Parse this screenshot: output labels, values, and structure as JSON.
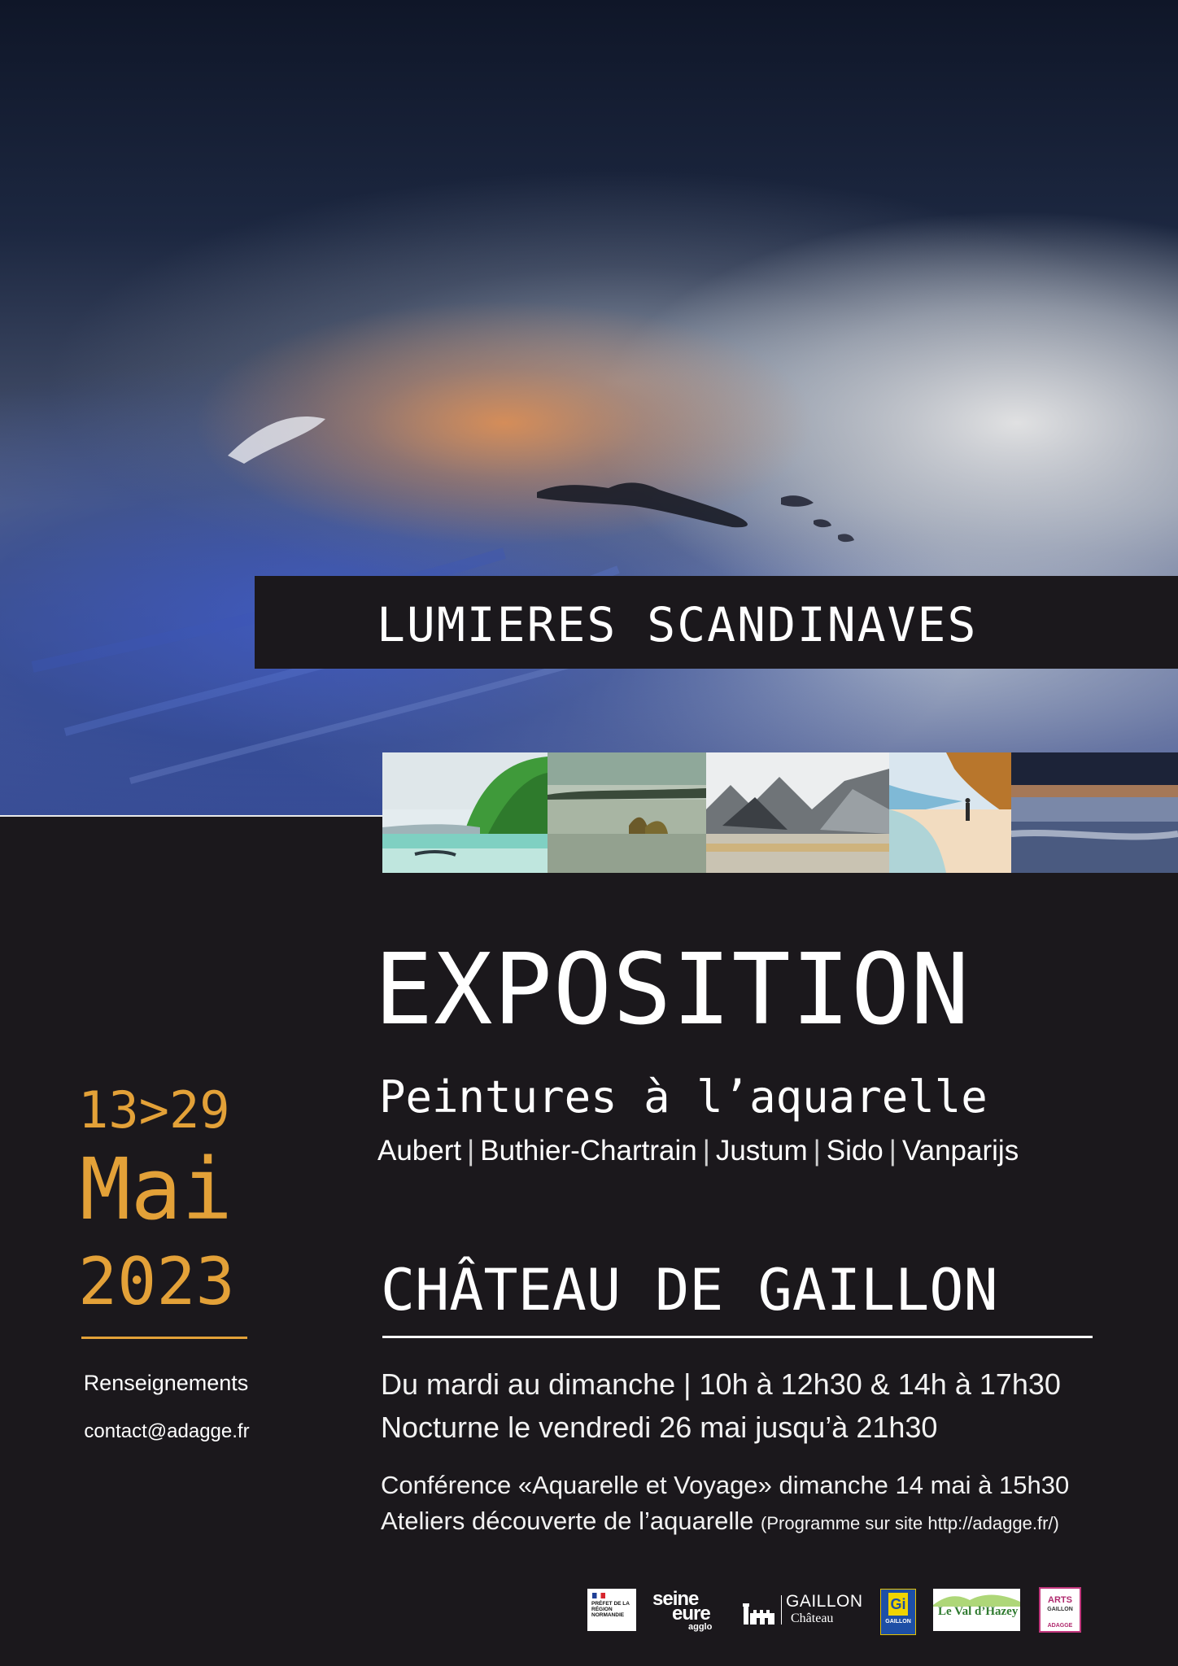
{
  "banner": {
    "title": "LUMIERES SCANDINAVES"
  },
  "main": {
    "heading": "EXPOSITION",
    "subtitle": "Peintures à l’aquarelle",
    "artists": [
      "Aubert",
      "Buthier-Chartrain",
      "Justum",
      "Sido",
      "Vanparijs"
    ]
  },
  "dates": {
    "range": "13>29",
    "month": "Mai",
    "year": "2023"
  },
  "info": {
    "label": "Renseignements",
    "contact": "contact@adagge.fr"
  },
  "venue": {
    "name": "CHÂTEAU DE GAILLON"
  },
  "schedule": {
    "line1": "Du mardi au dimanche | 10h à 12h30 & 14h à 17h30",
    "line2": "Nocturne le vendredi 26 mai jusqu’à 21h30",
    "line3": "Conférence «Aquarelle et Voyage» dimanche 14 mai à 15h30",
    "line4_main": "Ateliers découverte de l’aquarelle",
    "line4_note": "(Programme sur site http://adagge.fr/)"
  },
  "logos": {
    "prefet": "PRÉFET DE LA RÉGION NORMANDIE",
    "seine_l1": "seine",
    "seine_l2": "eure",
    "seine_l3": "agglo",
    "gaillon_name": "GAILLON",
    "gaillon_sub": "Château",
    "gaillon_blue_letters": "Gi",
    "gaillon_blue_text": "GAILLON",
    "valdhazey": "Le Val d’Hazey",
    "arts_title": "ARTS",
    "arts_sub": "GAILLON",
    "arts_bottom": "ADAGGE"
  },
  "colors": {
    "accent": "#e3a138",
    "background": "#1b181c"
  },
  "thumbnails": [
    {
      "name": "green-cliff-coast"
    },
    {
      "name": "calm-lake-rocks"
    },
    {
      "name": "grey-mountains"
    },
    {
      "name": "beach-walker"
    },
    {
      "name": "sunset-reflection"
    }
  ]
}
